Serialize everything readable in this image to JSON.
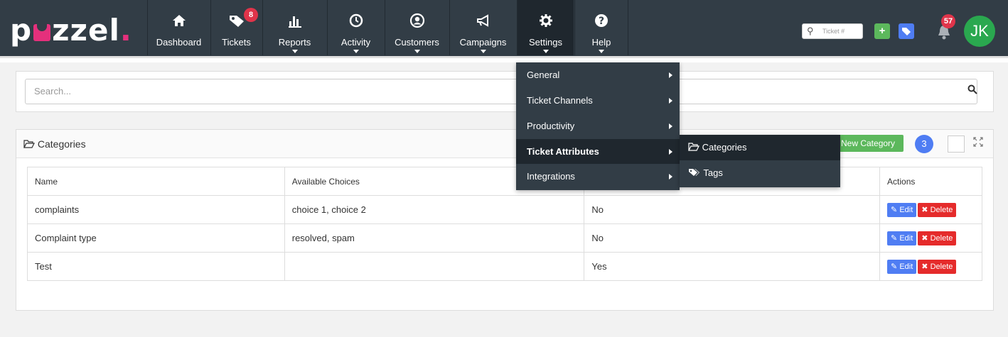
{
  "brand": {
    "name_start": "p",
    "name_end": "zzel",
    "dot": "."
  },
  "nav": {
    "items": [
      {
        "label": "Dashboard",
        "icon": "home-icon",
        "glyph": "⌂"
      },
      {
        "label": "Tickets",
        "icon": "ticket-tag-icon",
        "glyph": "▶",
        "badge": "8"
      },
      {
        "label": "Reports",
        "icon": "bar-chart-icon",
        "glyph": "▇"
      },
      {
        "label": "Activity",
        "icon": "history-icon",
        "glyph": "↺"
      },
      {
        "label": "Customers",
        "icon": "user-circle-icon",
        "glyph": "☺"
      },
      {
        "label": "Campaigns",
        "icon": "megaphone-icon",
        "glyph": "◁"
      },
      {
        "label": "Settings",
        "icon": "gear-icon",
        "glyph": "⚙"
      },
      {
        "label": "Help",
        "icon": "question-icon",
        "glyph": "?"
      }
    ],
    "ticket_search_placeholder": "Ticket #",
    "notification_count": "57",
    "avatar_initials": "JK",
    "colors": {
      "navbar": "#323d46",
      "badge": "#e0344a",
      "add_btn": "#5cb85c",
      "tag_btn": "#4f7df3",
      "avatar": "#2aa84f"
    }
  },
  "search": {
    "placeholder": "Search..."
  },
  "panel": {
    "title": "Categories",
    "new_button": "New Category",
    "count": "3"
  },
  "table": {
    "headers": [
      "Name",
      "Available Choices",
      "",
      "Actions"
    ],
    "rows": [
      {
        "name": "complaints",
        "choices": "choice 1, choice 2",
        "value": "No",
        "edit": "Edit",
        "delete": "Delete"
      },
      {
        "name": "Complaint type",
        "choices": "resolved, spam",
        "value": "No",
        "edit": "Edit",
        "delete": "Delete"
      },
      {
        "name": "Test",
        "choices": "",
        "value": "Yes",
        "edit": "Edit",
        "delete": "Delete"
      }
    ]
  },
  "settings_menu": {
    "items": [
      "General",
      "Ticket Channels",
      "Productivity",
      "Ticket Attributes",
      "Integrations"
    ],
    "submenu": [
      "Categories",
      "Tags"
    ]
  }
}
